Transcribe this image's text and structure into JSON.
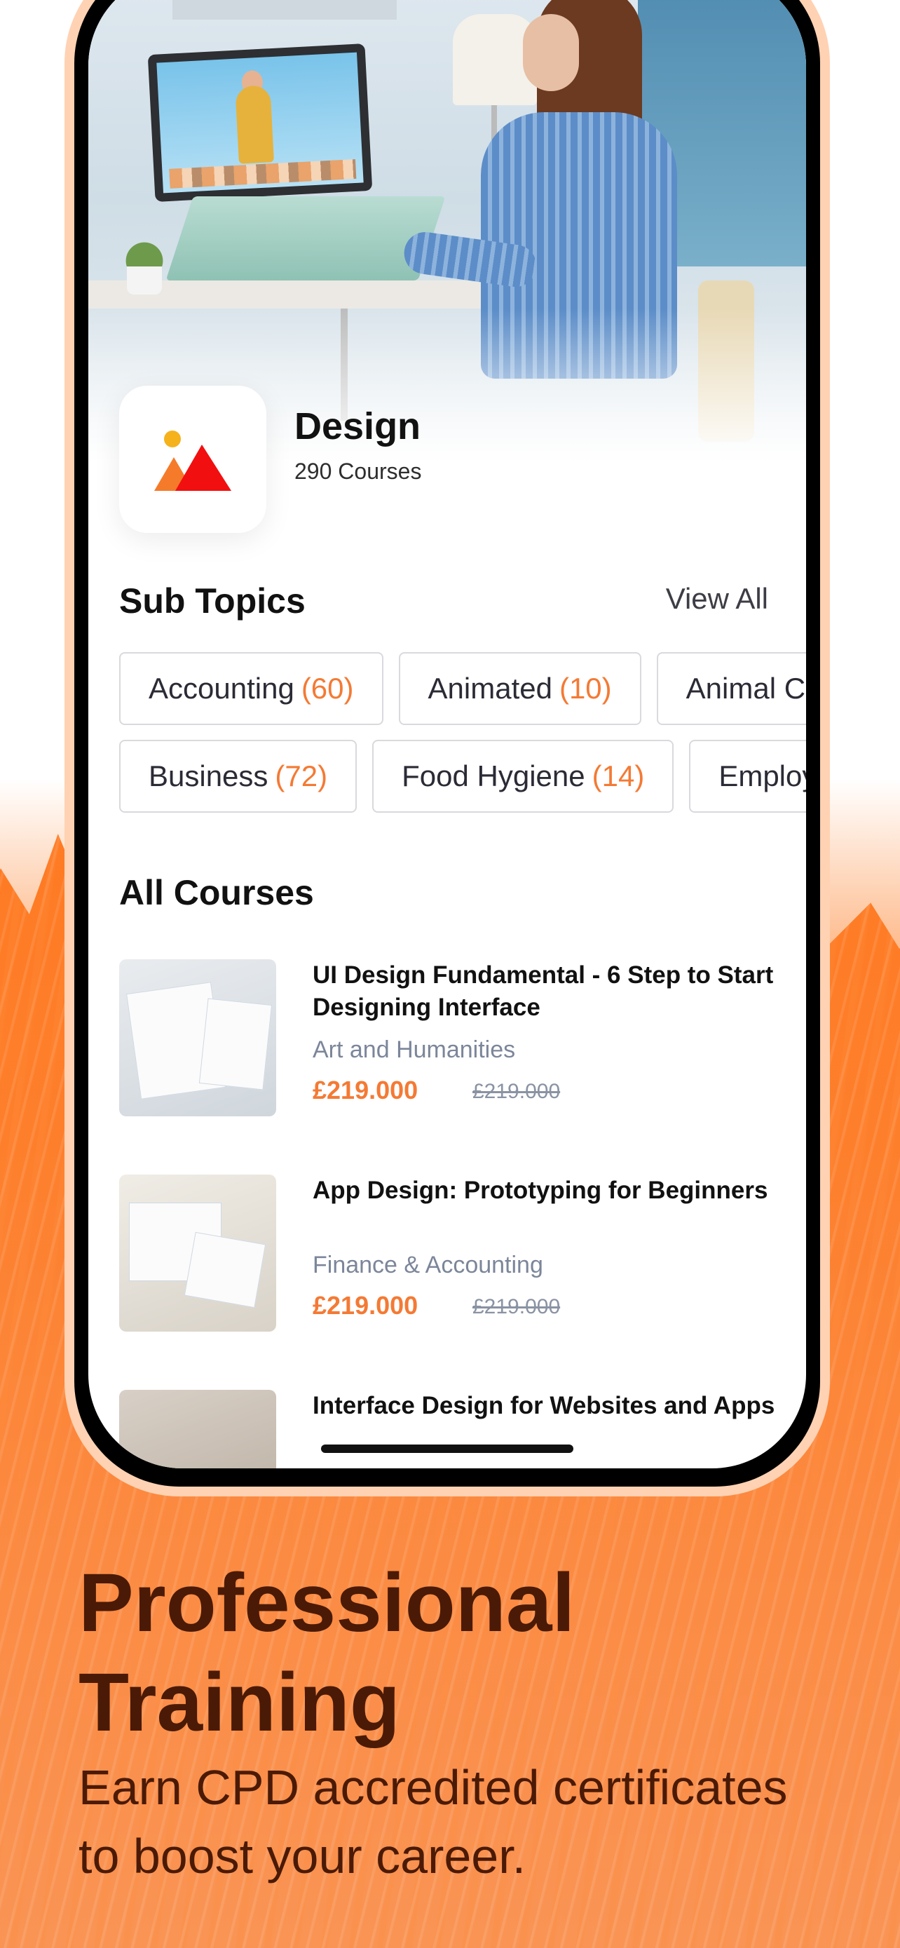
{
  "category": {
    "title": "Design",
    "count_label": "290 Courses",
    "icon": "image-icon"
  },
  "sub_topics": {
    "title": "Sub Topics",
    "view_all": "View All",
    "row1": [
      {
        "label": "Accounting",
        "count": "(60)"
      },
      {
        "label": "Animated",
        "count": "(10)"
      },
      {
        "label": "Animal C",
        "count": ""
      }
    ],
    "row2": [
      {
        "label": "Business",
        "count": "(72)"
      },
      {
        "label": "Food Hygiene",
        "count": "(14)"
      },
      {
        "label": "Employ",
        "count": ""
      }
    ]
  },
  "all_courses": {
    "title": "All Courses",
    "items": [
      {
        "title": "UI Design Fundamental - 6 Step to Start Designing Interface",
        "category": "Art and Humanities",
        "price": "£219.000",
        "old_price": "£219.000"
      },
      {
        "title": "App Design: Prototyping for Beginners",
        "category": "Finance & Accounting",
        "price": "£219.000",
        "old_price": "£219.000"
      },
      {
        "title": "Interface Design for Websites and Apps",
        "category": "",
        "price": "",
        "old_price": ""
      }
    ]
  },
  "promo": {
    "headline_line1": "Professional",
    "headline_line2": "Training",
    "subline_line1": "Earn CPD accredited certificates",
    "subline_line2": "to boost your career."
  },
  "colors": {
    "accent": "#f47a34",
    "headline": "#4a1a06",
    "background_orange": "#fd7f2c",
    "icon_triangle_red": "#f20f0f",
    "icon_triangle_orange": "#f57b2a",
    "icon_sun_yellow": "#f5b21b"
  }
}
